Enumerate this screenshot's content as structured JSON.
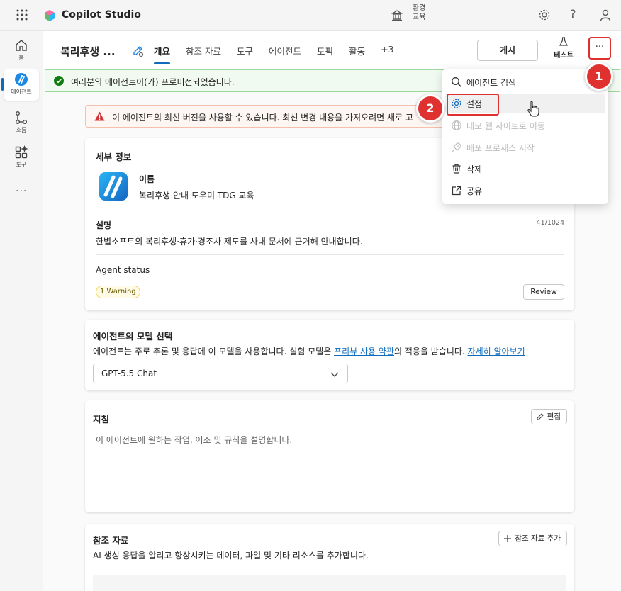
{
  "topbar": {
    "app_title": "Copilot Studio",
    "env_label_line1": "환경",
    "env_label_line2": "교육",
    "help_glyph": "?"
  },
  "rail": {
    "items": [
      {
        "label": "홈",
        "icon": "home-icon"
      },
      {
        "label": "에이전트",
        "icon": "agents-icon"
      },
      {
        "label": "흐름",
        "icon": "flows-icon"
      },
      {
        "label": "도구",
        "icon": "tools-icon"
      }
    ],
    "more": "···"
  },
  "header": {
    "agent_name": "복리후생 ...",
    "tabs": [
      "개요",
      "참조 자료",
      "도구",
      "에이전트",
      "토픽",
      "활동",
      "+3"
    ],
    "active_tab": "개요",
    "publish_label": "게시",
    "test_label": "테스트",
    "more_label": "···"
  },
  "banners": {
    "success": "여러분의 에이전트이(가) 프로비전되었습니다.",
    "warning": "이 에이전트의 최신 버전을 사용할 수 있습니다. 최신 변경 내용을 가져오려면 새로 고"
  },
  "details": {
    "title": "세부 정보",
    "name_label": "이름",
    "name_value": "복리후생 안내 도우미 TDG 교육",
    "desc_label": "설명",
    "desc_count": "41/1024",
    "desc_value": "한별소프트의 복리후생·휴가·경조사 제도를 사내 문서에 근거해 안내합니다.",
    "status_label": "Agent status",
    "warning_badge": "1 Warning",
    "review_label": "Review"
  },
  "model": {
    "title": "에이전트의 모델 선택",
    "desc_prefix": "에이전트는 주로 추론 및 응답에 이 모델을 사용합니다. 실험 모델은 ",
    "desc_link1": "프리뷰 사용 약관",
    "desc_mid": "의 적용을 받습니다. ",
    "desc_link2": "자세히 알아보기",
    "selected": "GPT-5.5 Chat"
  },
  "instructions": {
    "title": "지침",
    "edit_label": "편집",
    "placeholder": "이 에이전트에 원하는 작업, 어조 및 규칙을 설명합니다."
  },
  "knowledge": {
    "title": "참조 자료",
    "add_label": "참조 자료 추가",
    "desc": "AI 생성 응답을 알리고 향상시키는 데이터, 파일 및 기타 리소스를 추가합니다."
  },
  "menu": {
    "items": [
      {
        "label": "에이전트 검색",
        "icon": "search-icon",
        "disabled": false
      },
      {
        "label": "설정",
        "icon": "gear-icon",
        "disabled": false
      },
      {
        "label": "데모 웹 사이트로 이동",
        "icon": "globe-icon",
        "disabled": true
      },
      {
        "label": "배포 프로세스 시작",
        "icon": "rocket-icon",
        "disabled": true
      },
      {
        "label": "삭제",
        "icon": "trash-icon",
        "disabled": false
      },
      {
        "label": "공유",
        "icon": "share-icon",
        "disabled": false
      }
    ]
  },
  "annotations": {
    "step1": "1",
    "step2": "2"
  },
  "colors": {
    "accent": "#0f6cbd",
    "annotation_red": "#e03131",
    "success_bg": "#f1faf1",
    "warning_bg": "#fdf6f3"
  }
}
